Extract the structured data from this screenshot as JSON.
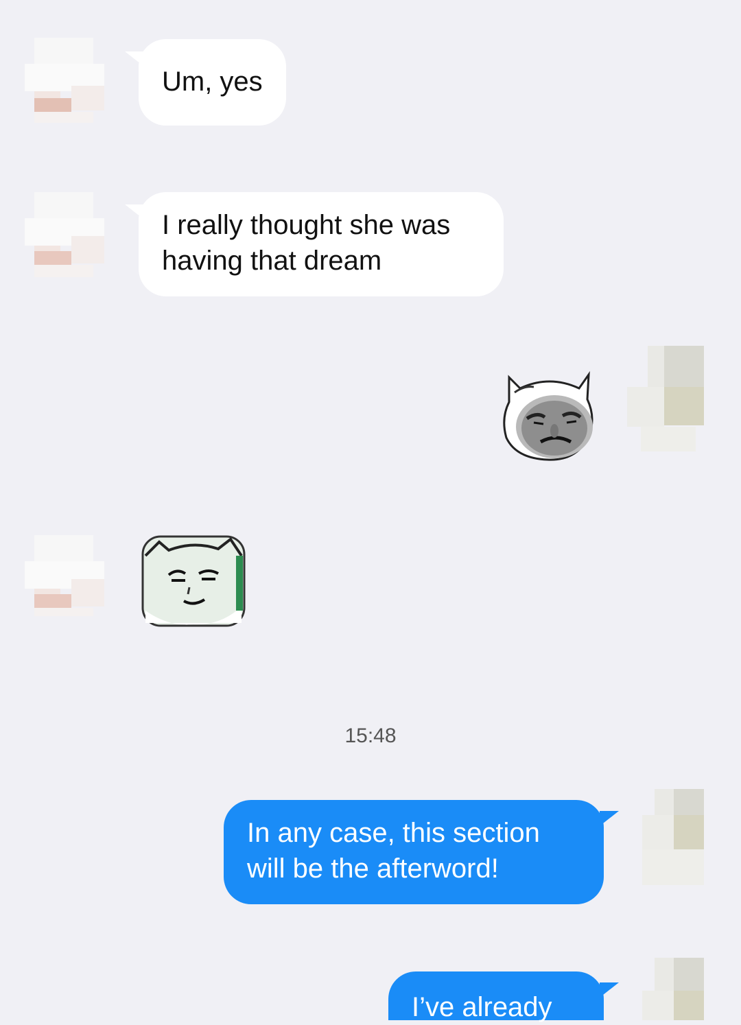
{
  "messages": [
    {
      "direction": "incoming",
      "type": "text",
      "lines": [
        "Um, yes"
      ]
    },
    {
      "direction": "incoming",
      "type": "text",
      "lines": [
        "I really thought she was",
        "having that dream"
      ]
    },
    {
      "direction": "outgoing",
      "type": "sticker",
      "sticker": "squinting-face-sticker"
    },
    {
      "direction": "incoming",
      "type": "sticker",
      "sticker": "awkward-face-sticker"
    },
    {
      "type": "timestamp",
      "text": "15:48"
    },
    {
      "direction": "outgoing",
      "type": "text",
      "lines": [
        "In any case, this section",
        "will be the afterword!"
      ]
    },
    {
      "direction": "outgoing",
      "type": "text",
      "lines": [
        "I’ve already"
      ]
    }
  ],
  "colors": {
    "background": "#f0f0f5",
    "incoming_bubble": "#ffffff",
    "outgoing_bubble": "#1a8cf7",
    "outgoing_text": "#ffffff"
  }
}
